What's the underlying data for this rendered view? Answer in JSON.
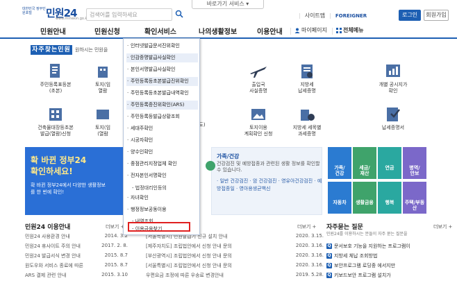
{
  "header": {
    "emblem_text": "대한민국 정부민원포털",
    "brand": "민원24",
    "brand_sub": "www.minwon.go.kr",
    "search_placeholder": "검색어를 입력하세요",
    "shortcut": "바로가기 서비스",
    "sitemap": "사이트맵",
    "foreigner": "FOREIGNER",
    "login": "로그인",
    "join": "회원가입"
  },
  "gnb": {
    "items": [
      "민원안내",
      "민원신청",
      "확인서비스",
      "나의생활정보",
      "이용안내"
    ],
    "mypage": "마이페이지",
    "allmenu": "전체메뉴"
  },
  "jaju": {
    "title": "자주찾는민원",
    "desc": "원하시는 민원을"
  },
  "services": [
    {
      "label": "주민등록표등본\n(초본)"
    },
    {
      "label": "토지(임\n열람"
    },
    {
      "label": "출입국\n사실증명"
    },
    {
      "label": "지방세\n납세증명"
    },
    {
      "label": "개별 공시지가\n확인"
    },
    {
      "label": "건축물대장등초본\n발급(열람)신청"
    },
    {
      "label": "토지(임\n(열람"
    },
    {
      "label": "도)"
    },
    {
      "label": "토지이용\n계획확인 신청"
    },
    {
      "label": "지방세 세목별\n과세증명"
    },
    {
      "label": "납세증명서"
    }
  ],
  "dropdown": {
    "items": [
      "인터넷발급문서진위확인",
      "인감증명발급사실확인",
      "본인서명발급사실확인",
      "주민등록등초본발급진위확인",
      "주민등록등초본발급내역확인",
      "주민등록증진위확인(ARS)",
      "주민등록등발급상황조회",
      "세대주확인",
      "시공자확인",
      "양수인확인",
      "중점관리지정업체 확인",
      "전자본인서명확인",
      "자녀확인",
      "행정정보공동이용"
    ],
    "sub1": "법정대리인등의",
    "sub2": "내역조회",
    "sub3": "이용금융찾기"
  },
  "banner": {
    "line1": "확 바뀐 정부24",
    "line2": "확인하세요!",
    "line3": "확 바뀐 정부24에서 다양한 생활정보를 한 번에 확인!"
  },
  "health": {
    "title": "가족/건강",
    "desc": "건강검진 및 예방접종과 관련된 생활 정보를 확인할 수 있습니다.",
    "links": "· 일반 건강검진 · 암 건강검진 · 영유아건강검진 · 예방접종일 · 영아용생균백신"
  },
  "tiles": [
    {
      "label": "가족/\n건강",
      "color": "#2b7bd1"
    },
    {
      "label": "세금/\n재산",
      "color": "#3fa36b"
    },
    {
      "label": "연금",
      "color": "#2aa8a0"
    },
    {
      "label": "병역/\n안보",
      "color": "#7b68c9"
    },
    {
      "label": "자동차",
      "color": "#2b7bd1"
    },
    {
      "label": "생활금융",
      "color": "#3fa36b"
    },
    {
      "label": "행복",
      "color": "#2aa8a0"
    },
    {
      "label": "주택/부동산",
      "color": "#7b68c9"
    }
  ],
  "notice": {
    "title": "민원24 이용안내",
    "more": "더보기",
    "rows": [
      {
        "title": "민원24 사용환경 안내",
        "date": "2014. 3.2"
      },
      {
        "title": "민원24 휴사이트 주의 안내",
        "date": "2017. 2. 8."
      },
      {
        "title": "민원24 발급서식 변경 안내",
        "date": "2015. 8.7"
      },
      {
        "title": "원도우와 서비스 종료에 따른",
        "date": "2015. 8.7"
      },
      {
        "title": "ARS 결제 관련 안내",
        "date": "2015. 3.10"
      }
    ]
  },
  "notice2": {
    "more": "더보기",
    "rows": [
      {
        "title": "[서울특별시] 민원발급기 신규 설치 안내",
        "date": "2020. 3.15."
      },
      {
        "title": "[제주자치도] 조립법안에서 신청 안내 문의",
        "date": "2020. 3.16."
      },
      {
        "title": "[부산광역시] 조립법안에서 신청 안내 문의",
        "date": "2020. 3.16."
      },
      {
        "title": "[서울특별시] 조립법안에서 신청 안내 문의",
        "date": "2020. 3.16."
      },
      {
        "title": "우편요금 조정에 따른 우송료 변경안내",
        "date": "2019. 5.28."
      }
    ]
  },
  "faq": {
    "title": "자주묻는 질문",
    "more": "더보기",
    "desc": "민원24를 이용하시는 분들이 자주 묻는 질문을",
    "rows": [
      "문서보호 기능을 지원하는 프로그램이",
      "지방세 체납 조회방법",
      "보안프로그램 로딩중 에서지만",
      "키보드보안 프로그램 설치가"
    ]
  }
}
